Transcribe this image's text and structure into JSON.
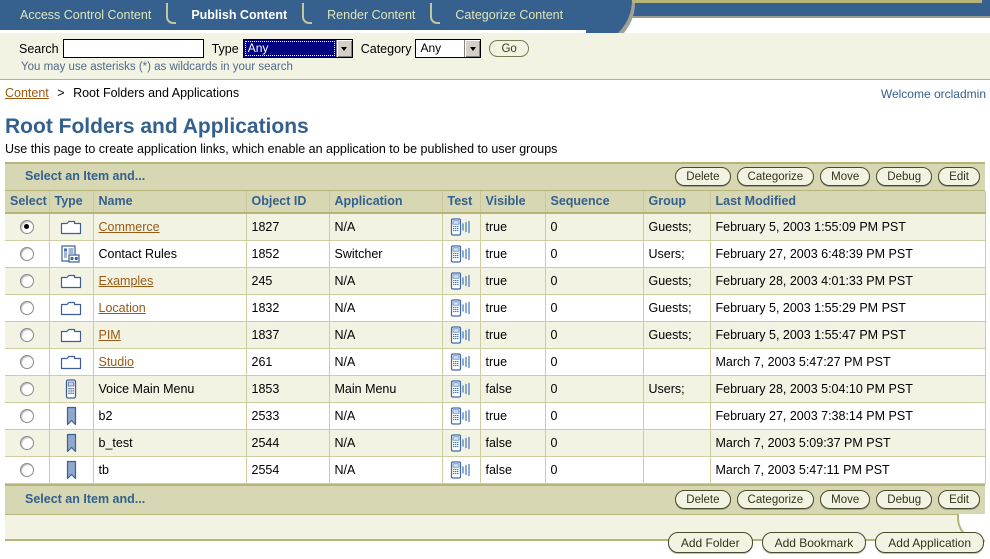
{
  "tabs": [
    {
      "label": "Access Control Content",
      "active": false
    },
    {
      "label": "Publish Content",
      "active": true
    },
    {
      "label": "Render Content",
      "active": false
    },
    {
      "label": "Categorize Content",
      "active": false
    }
  ],
  "search": {
    "label": "Search",
    "value": "",
    "placeholder": "",
    "type_label": "Type",
    "type_value": "Any",
    "category_label": "Category",
    "category_value": "Any",
    "go_label": "Go",
    "hint": "You may use asterisks (*) as wildcards in your search"
  },
  "breadcrumb": {
    "root": "Content",
    "separator": ">",
    "current": "Root Folders and Applications"
  },
  "welcome": "Welcome orcladmin",
  "page": {
    "title": "Root Folders and Applications",
    "description": "Use this page to create application links, which enable an application to be published to user groups"
  },
  "actionbar": {
    "title": "Select an Item and...",
    "buttons": [
      "Delete",
      "Categorize",
      "Move",
      "Debug",
      "Edit"
    ]
  },
  "table": {
    "columns": [
      "Select",
      "Type",
      "Name",
      "Object ID",
      "Application",
      "Test",
      "Visible",
      "Sequence",
      "Group",
      "Last Modified"
    ],
    "rows": [
      {
        "selected": true,
        "icon": "folder-icon",
        "name": "Commerce",
        "link": true,
        "object_id": "1827",
        "application": "N/A",
        "test": "phone-test-icon",
        "visible": "true",
        "sequence": "0",
        "group": "Guests;",
        "last_modified": "February 5, 2003 1:55:09 PM PST"
      },
      {
        "selected": false,
        "icon": "contact-rules-icon",
        "name": "Contact Rules",
        "link": false,
        "object_id": "1852",
        "application": "Switcher",
        "test": "phone-test-icon",
        "visible": "true",
        "sequence": "0",
        "group": "Users;",
        "last_modified": "February 27, 2003 6:48:39 PM PST"
      },
      {
        "selected": false,
        "icon": "folder-icon",
        "name": "Examples",
        "link": true,
        "object_id": "245",
        "application": "N/A",
        "test": "phone-test-icon",
        "visible": "true",
        "sequence": "0",
        "group": "Guests;",
        "last_modified": "February 28, 2003 4:01:33 PM PST"
      },
      {
        "selected": false,
        "icon": "folder-icon",
        "name": "Location",
        "link": true,
        "object_id": "1832",
        "application": "N/A",
        "test": "phone-test-icon",
        "visible": "true",
        "sequence": "0",
        "group": "Guests;",
        "last_modified": "February 5, 2003 1:55:29 PM PST"
      },
      {
        "selected": false,
        "icon": "folder-icon",
        "name": "PIM",
        "link": true,
        "object_id": "1837",
        "application": "N/A",
        "test": "phone-test-icon",
        "visible": "true",
        "sequence": "0",
        "group": "Guests;",
        "last_modified": "February 5, 2003 1:55:47 PM PST"
      },
      {
        "selected": false,
        "icon": "folder-icon",
        "name": "Studio",
        "link": true,
        "object_id": "261",
        "application": "N/A",
        "test": "phone-test-icon",
        "visible": "true",
        "sequence": "0",
        "group": "",
        "last_modified": "March 7, 2003 5:47:27 PM PST"
      },
      {
        "selected": false,
        "icon": "phone-app-icon",
        "name": "Voice Main Menu",
        "link": false,
        "object_id": "1853",
        "application": "Main Menu",
        "test": "phone-test-icon",
        "visible": "false",
        "sequence": "0",
        "group": "Users;",
        "last_modified": "February 28, 2003 5:04:10 PM PST"
      },
      {
        "selected": false,
        "icon": "bookmark-icon",
        "name": "b2",
        "link": false,
        "object_id": "2533",
        "application": "N/A",
        "test": "phone-test-icon",
        "visible": "true",
        "sequence": "0",
        "group": "",
        "last_modified": "February 27, 2003 7:38:14 PM PST"
      },
      {
        "selected": false,
        "icon": "bookmark-icon",
        "name": "b_test",
        "link": false,
        "object_id": "2544",
        "application": "N/A",
        "test": "phone-test-icon",
        "visible": "false",
        "sequence": "0",
        "group": "",
        "last_modified": "March 7, 2003 5:09:37 PM PST"
      },
      {
        "selected": false,
        "icon": "bookmark-icon",
        "name": "tb",
        "link": false,
        "object_id": "2554",
        "application": "N/A",
        "test": "phone-test-icon",
        "visible": "false",
        "sequence": "0",
        "group": "",
        "last_modified": "March 7, 2003 5:47:11 PM PST"
      }
    ]
  },
  "footer": {
    "title": "Select an Item and...",
    "buttons": [
      "Delete",
      "Categorize",
      "Move",
      "Debug",
      "Edit"
    ],
    "bottom_buttons": [
      "Add Folder",
      "Add Bookmark",
      "Add Application"
    ]
  },
  "colors": {
    "tab_blue": "#36618e",
    "panel_cream": "#f3f3e3",
    "header_khaki": "#d7d7b4",
    "link_brown": "#9a5a14",
    "heading_blue": "#33608e",
    "rule_olive": "#b5b57a"
  }
}
